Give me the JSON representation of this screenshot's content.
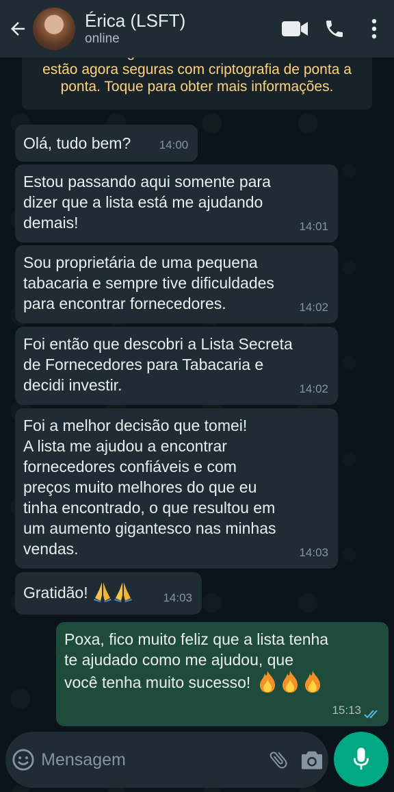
{
  "header": {
    "contact_name": "Érica (LSFT)",
    "status": "online",
    "icons": [
      "back-arrow-icon",
      "video-call-icon",
      "phone-icon",
      "more-vert-icon"
    ]
  },
  "encryption_notice": {
    "line1": "As mensagens e chamadas desta conversa",
    "line2": "estão agora seguras com criptografia de ponta a",
    "line3": "ponta. Toque para obter mais informações."
  },
  "messages": [
    {
      "direction": "in",
      "text": "Olá, tudo bem?",
      "time": "14:00"
    },
    {
      "direction": "in",
      "text": "Estou passando aqui somente para\ndizer que a lista está me ajudando\ndemais!",
      "time": "14:01"
    },
    {
      "direction": "in",
      "text": "Sou proprietária de uma pequena\ntabacaria e sempre tive dificuldades\npara encontrar fornecedores.",
      "time": "14:02"
    },
    {
      "direction": "in",
      "text": "Foi então que descobri a Lista Secreta\nde Fornecedores para Tabacaria e\ndecidi investir.",
      "time": "14:02"
    },
    {
      "direction": "in",
      "text": "Foi a melhor decisão que tomei!\nA lista me ajudou a encontrar\nfornecedores confiáveis e com\npreços muito melhores do que eu\ntinha encontrado, o que resultou em\num aumento gigantesco nas minhas\nvendas.",
      "time": "14:03"
    },
    {
      "direction": "in",
      "text": "Gratidão!",
      "emoji": [
        "folded-hands",
        "folded-hands"
      ],
      "time": "14:03"
    },
    {
      "direction": "out",
      "text": "Poxa, fico muito feliz que a lista tenha\nte ajudado como me ajudou, que\nvocê tenha muito sucesso!",
      "emoji": [
        "fire",
        "fire",
        "fire"
      ],
      "time": "15:13",
      "status": "read"
    }
  ],
  "composer": {
    "placeholder": "Mensagem",
    "icons": [
      "emoji-icon",
      "attach-icon",
      "camera-icon",
      "mic-icon"
    ]
  },
  "colors": {
    "background": "#0b141a",
    "header": "#1f2c33",
    "incoming_bubble": "#1f2c33",
    "outgoing_bubble": "#1f4b3d",
    "notice_text": "#ffd279",
    "accent": "#00a884",
    "read_ticks": "#53bdeb"
  }
}
